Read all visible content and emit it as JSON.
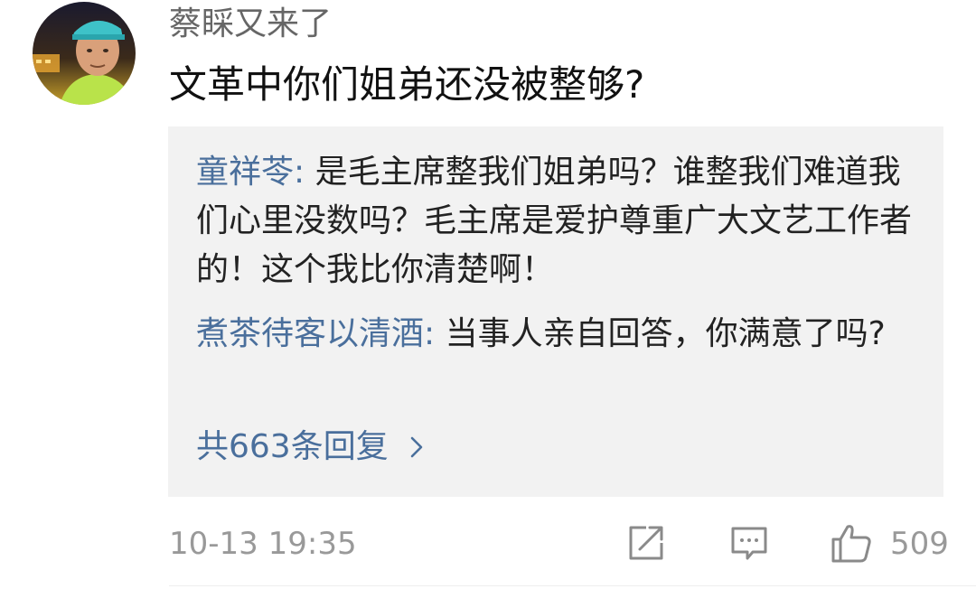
{
  "comment": {
    "username": "蔡睬又来了",
    "text": "文革中你们姐弟还没被整够?",
    "avatar_icon": "user-avatar"
  },
  "replies": [
    {
      "author": "童祥苓",
      "colon": ": ",
      "text": "是毛主席整我们姐弟吗？谁整我们难道我们心里没数吗？毛主席是爱护尊重广大文艺工作者的！这个我比你清楚啊！"
    },
    {
      "author": "煮茶待客以清酒",
      "colon": ": ",
      "text": "当事人亲自回答，你满意了吗?"
    }
  ],
  "reply_summary": {
    "label": "共663条回复",
    "icon": "chevron-right-icon"
  },
  "footer": {
    "timestamp": "10-13 19:35",
    "share_icon": "share-icon",
    "reply_icon": "comment-icon",
    "like_icon": "thumbs-up-icon",
    "like_count": "509"
  },
  "colors": {
    "link": "#4a6f9c",
    "reply_background": "#f2f2f2",
    "meta_text": "#999999"
  }
}
